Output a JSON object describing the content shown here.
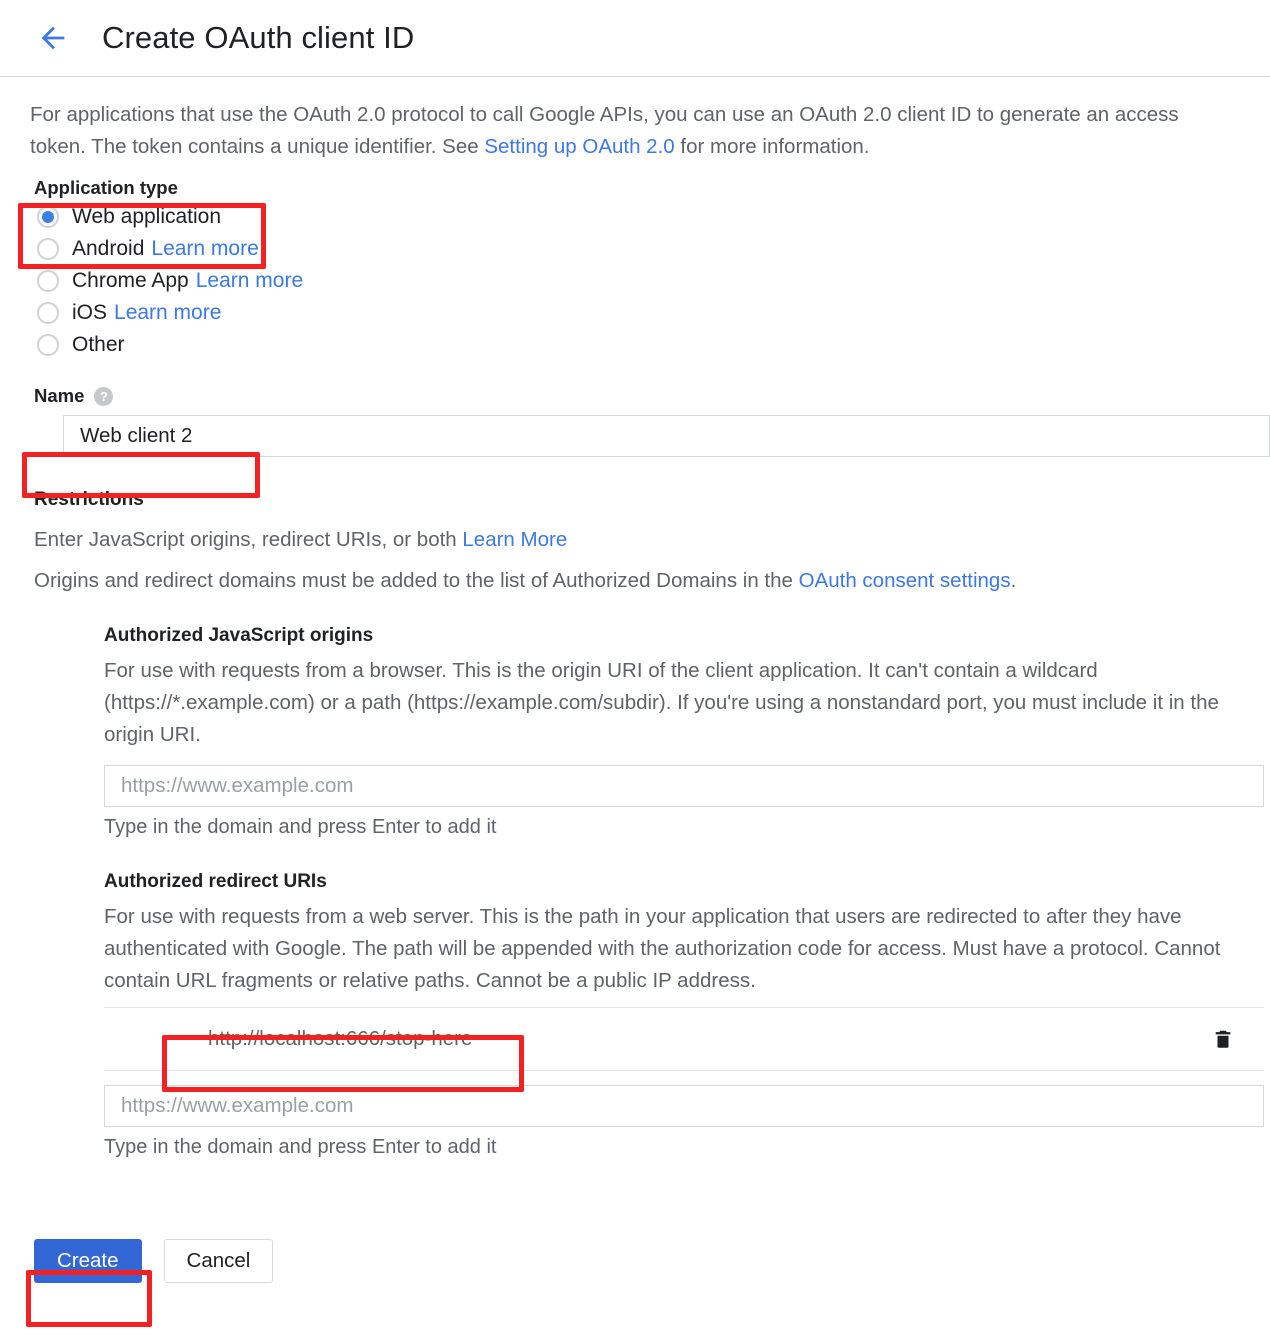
{
  "header": {
    "back_icon": "back-arrow-icon",
    "title": "Create OAuth client ID"
  },
  "intro": {
    "part1": "For applications that use the OAuth 2.0 protocol to call Google APIs, you can use an OAuth 2.0 client ID to generate an access token. The token contains a unique identifier. See ",
    "link": "Setting up OAuth 2.0",
    "part2": " for more information."
  },
  "application_type": {
    "label": "Application type",
    "selected": "Web application",
    "options": [
      {
        "label": "Web application",
        "learn_more": "",
        "checked": true
      },
      {
        "label": "Android",
        "learn_more": "Learn more",
        "checked": false
      },
      {
        "label": "Chrome App",
        "learn_more": "Learn more",
        "checked": false
      },
      {
        "label": "iOS",
        "learn_more": "Learn more",
        "checked": false
      },
      {
        "label": "Other",
        "learn_more": "",
        "checked": false
      }
    ]
  },
  "name": {
    "label": "Name",
    "help_icon": "help-icon",
    "value": "Web client 2"
  },
  "restrictions": {
    "title": "Restrictions",
    "line1_text": "Enter JavaScript origins, redirect URIs, or both ",
    "line1_link": "Learn More",
    "line2_part1": "Origins and redirect domains must be added to the list of Authorized Domains in the ",
    "line2_link": "OAuth consent settings",
    "line2_part2": "."
  },
  "javascript_origins": {
    "title": "Authorized JavaScript origins",
    "description": "For use with requests from a browser. This is the origin URI of the client application. It can't contain a wildcard (https://*.example.com) or a path (https://example.com/subdir). If you're using a nonstandard port, you must include it in the origin URI.",
    "placeholder": "https://www.example.com",
    "value": "",
    "hint": "Type in the domain and press Enter to add it"
  },
  "redirect_uris": {
    "title": "Authorized redirect URIs",
    "description": "For use with requests from a web server. This is the path in your application that users are redirected to after they have authenticated with Google. The path will be appended with the authorization code for access. Must have a protocol. Cannot contain URL fragments or relative paths. Cannot be a public IP address.",
    "entries": [
      {
        "value": "http://localhost:666/stop-here",
        "delete_icon": "trash-icon"
      }
    ],
    "placeholder": "https://www.example.com",
    "value": "",
    "hint": "Type in the domain and press Enter to add it"
  },
  "actions": {
    "create": "Create",
    "cancel": "Cancel"
  },
  "colors": {
    "accent_blue": "#3367d6",
    "link_blue": "#3c78e6",
    "annotation_red": "#f32121",
    "radio_blue": "#3f7ee6"
  }
}
